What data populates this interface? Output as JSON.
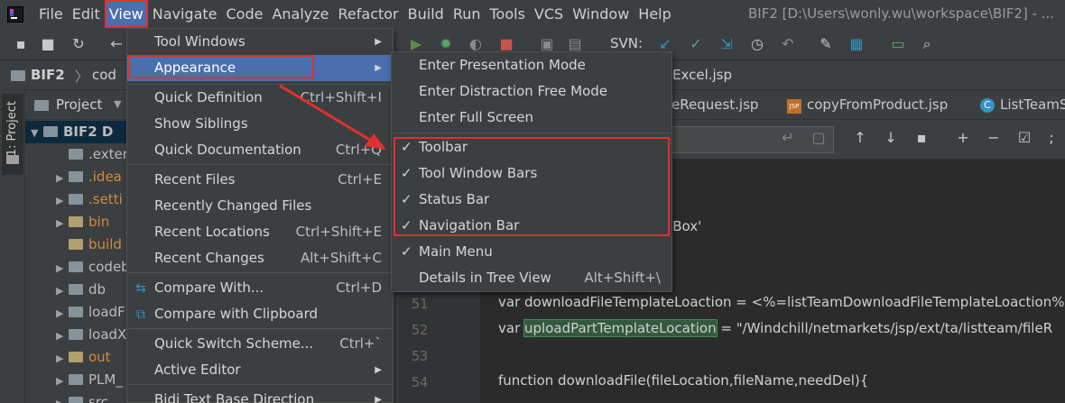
{
  "menubar": {
    "items": [
      "File",
      "Edit",
      "View",
      "Navigate",
      "Code",
      "Analyze",
      "Refactor",
      "Build",
      "Run",
      "Tools",
      "VCS",
      "Window",
      "Help"
    ],
    "window_title": "BIF2 [D:\\Users\\wonly.wu\\workspace\\BIF2] - ..."
  },
  "toolbar": {
    "svn_label": "SVN:"
  },
  "navbar": {
    "crumb_project": "BIF2",
    "crumb_next": "cod",
    "file": "Excel.jsp"
  },
  "project_panel": {
    "title": "Project",
    "strip_label": "1: Project",
    "items": [
      {
        "label": "BIF2  D"
      },
      {
        "label": ".exter"
      },
      {
        "label": ".idea"
      },
      {
        "label": ".setti"
      },
      {
        "label": "bin"
      },
      {
        "label": "build"
      },
      {
        "label": "codeb"
      },
      {
        "label": "db"
      },
      {
        "label": "loadF"
      },
      {
        "label": "loadX"
      },
      {
        "label": "out"
      },
      {
        "label": "PLM_"
      },
      {
        "label": "src"
      }
    ]
  },
  "editor_tabs": [
    {
      "label": "eRequest.jsp"
    },
    {
      "label": "copyFromProduct.jsp"
    },
    {
      "label": "ListTeamS"
    }
  ],
  "code": {
    "lines": [
      {
        "num": "",
        "text": ""
      },
      {
        "num": "",
        "text": "eBox'"
      },
      {
        "num": "51",
        "text": "var downloadFileTemplateLoaction = <%=listTeamDownloadFileTemplateLoaction%>;"
      },
      {
        "num": "52",
        "pre": "var ",
        "var": "uploadPartTemplateLocation",
        "post": " = \"/Windchill/netmarkets/jsp/ext/ta/listteam/fileR"
      },
      {
        "num": "53",
        "text": ""
      },
      {
        "num": "54",
        "text": "function downloadFile(fileLocation,fileName,needDel){"
      }
    ]
  },
  "view_menu": {
    "items": [
      {
        "label": "Tool Windows",
        "shortcut": "",
        "submenu": true
      },
      {
        "label": "Appearance",
        "shortcut": "",
        "submenu": true
      },
      {
        "label": "Quick Definition",
        "shortcut": "Ctrl+Shift+I",
        "submenu": false
      },
      {
        "label": "Show Siblings",
        "shortcut": "",
        "submenu": false
      },
      {
        "label": "Quick Documentation",
        "shortcut": "Ctrl+Q",
        "submenu": false
      },
      {
        "label": "Recent Files",
        "shortcut": "Ctrl+E",
        "submenu": false
      },
      {
        "label": "Recently Changed Files",
        "shortcut": "",
        "submenu": false
      },
      {
        "label": "Recent Locations",
        "shortcut": "Ctrl+Shift+E",
        "submenu": false
      },
      {
        "label": "Recent Changes",
        "shortcut": "Alt+Shift+C",
        "submenu": false
      },
      {
        "label": "Compare With...",
        "shortcut": "Ctrl+D",
        "submenu": false
      },
      {
        "label": "Compare with Clipboard",
        "shortcut": "",
        "submenu": false
      },
      {
        "label": "Quick Switch Scheme...",
        "shortcut": "Ctrl+`",
        "submenu": false
      },
      {
        "label": "Active Editor",
        "shortcut": "",
        "submenu": true
      },
      {
        "label": "Bidi Text Base Direction",
        "shortcut": "",
        "submenu": true
      }
    ]
  },
  "appearance_menu": {
    "items": [
      {
        "label": "Enter Presentation Mode",
        "checked": false,
        "shortcut": ""
      },
      {
        "label": "Enter Distraction Free Mode",
        "checked": false,
        "shortcut": ""
      },
      {
        "label": "Enter Full Screen",
        "checked": false,
        "shortcut": ""
      },
      {
        "label": "Toolbar",
        "checked": true,
        "shortcut": ""
      },
      {
        "label": "Tool Window Bars",
        "checked": true,
        "shortcut": ""
      },
      {
        "label": "Status Bar",
        "checked": true,
        "shortcut": ""
      },
      {
        "label": "Navigation Bar",
        "checked": true,
        "shortcut": ""
      },
      {
        "label": "Main Menu",
        "checked": true,
        "shortcut": ""
      },
      {
        "label": "Details in Tree View",
        "checked": false,
        "shortcut": "Alt+Shift+\\"
      }
    ]
  },
  "colors": {
    "accent": "#4b6eaf",
    "highlight_box": "#e03030",
    "background": "#2b2b2b",
    "panel": "#3c3f41"
  }
}
